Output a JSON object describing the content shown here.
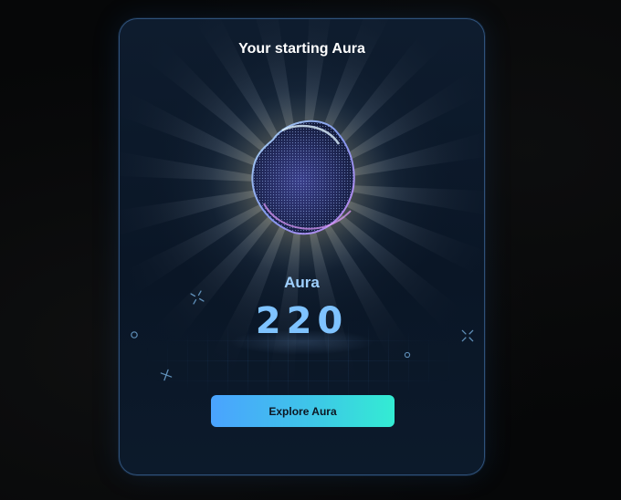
{
  "modal": {
    "title": "Your starting Aura",
    "aura_label": "Aura",
    "aura_value": "220",
    "cta_label": "Explore Aura"
  },
  "colors": {
    "accent_start": "#4aa3ff",
    "accent_end": "#33ecd3",
    "value_color": "#7fc3ff",
    "border": "#5a96dc"
  },
  "icons": [
    "aura-orb-icon",
    "sparkle-icon",
    "ring-dot-icon",
    "plus-star-icon"
  ]
}
